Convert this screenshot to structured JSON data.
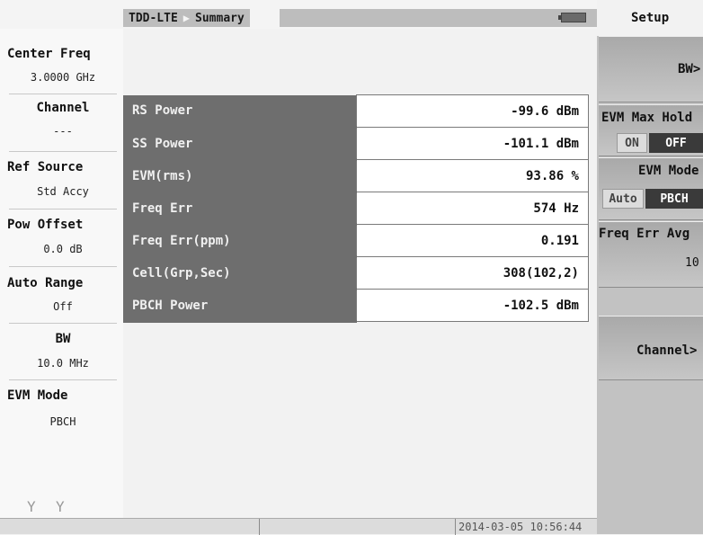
{
  "header": {
    "mode": "TDD-LTE",
    "view": "Summary"
  },
  "left_panel": [
    {
      "label": "Center Freq",
      "value": "3.0000 GHz"
    },
    {
      "label": "Channel",
      "value": "---"
    },
    {
      "label": "Ref Source",
      "value": "Std Accy"
    },
    {
      "label": "Pow Offset",
      "value": "0.0 dB"
    },
    {
      "label": "Auto Range",
      "value": "Off"
    },
    {
      "label": "BW",
      "value": "10.0 MHz"
    },
    {
      "label": "EVM Mode",
      "value": "PBCH"
    }
  ],
  "summary_table": [
    {
      "label": "RS Power",
      "value": "-99.6 dBm"
    },
    {
      "label": "SS Power",
      "value": "-101.1 dBm"
    },
    {
      "label": "EVM(rms)",
      "value": "93.86 %"
    },
    {
      "label": "Freq Err",
      "value": "574 Hz"
    },
    {
      "label": "Freq Err(ppm)",
      "value": "0.191"
    },
    {
      "label": "Cell(Grp,Sec)",
      "value": "308(102,2)"
    },
    {
      "label": "PBCH Power",
      "value": "-102.5 dBm"
    }
  ],
  "status_bar": {
    "timestamp": "2014-03-05 10:56:44"
  },
  "right_panel": {
    "title": "Setup",
    "bw_key": "BW>",
    "evm_max_hold": {
      "label": "EVM Max Hold",
      "on": "ON",
      "off": "OFF",
      "selected": "OFF"
    },
    "evm_mode": {
      "label": "EVM Mode",
      "auto": "Auto",
      "pbch": "PBCH",
      "selected": "PBCH"
    },
    "freq_err_avg": {
      "label": "Freq Err Avg",
      "value": "10"
    },
    "channel_key": "Channel>"
  },
  "icons": [
    "battery-icon",
    "antenna-icon",
    "antenna-icon"
  ]
}
